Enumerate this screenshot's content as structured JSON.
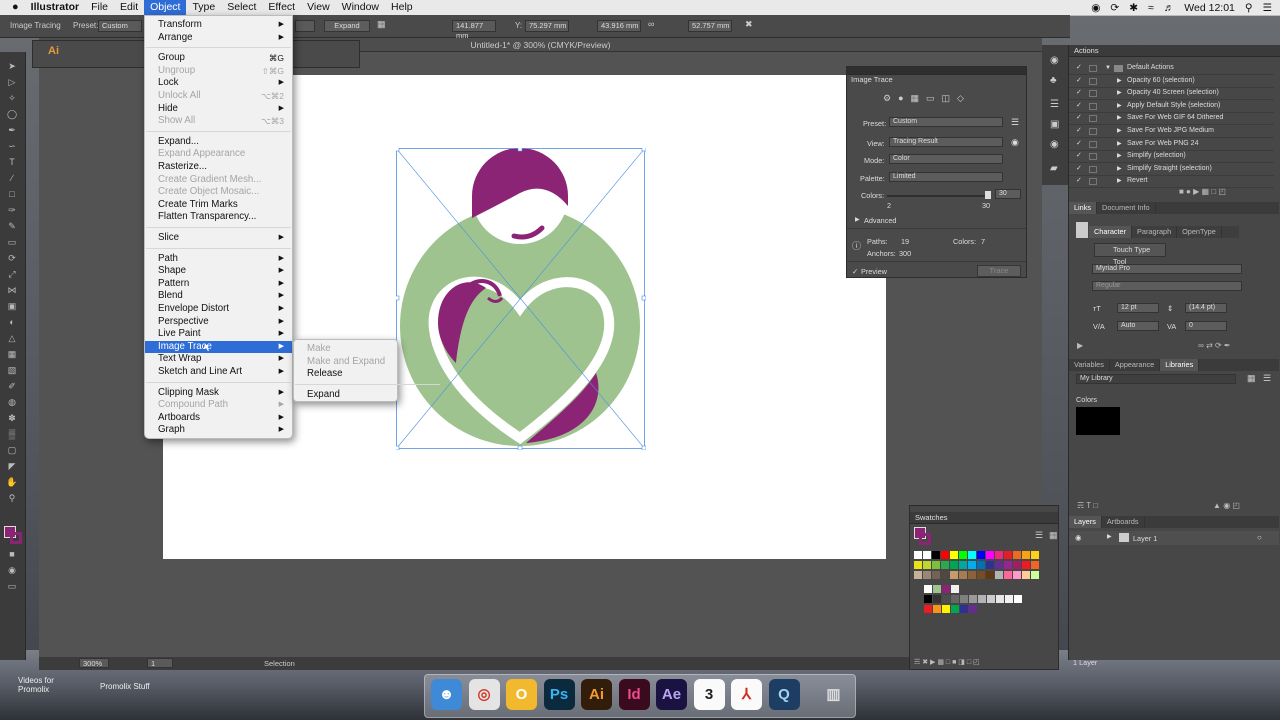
{
  "menubar": {
    "apple": "",
    "app_name": "Illustrator",
    "items": [
      "File",
      "Edit",
      "Object",
      "Type",
      "Select",
      "Effect",
      "View",
      "Window",
      "Help"
    ],
    "active": "Object",
    "clock": "Wed 12:01"
  },
  "control_bar": {
    "mode_label": "Image Tracing",
    "preset_label": "Preset:",
    "preset_value": "Custom",
    "expand_button": "Expand",
    "x_value": "141.877 mm",
    "y_label": "Y:",
    "y_value": "75.297 mm",
    "w_value": "43.916 mm",
    "h_value": "52.757 mm"
  },
  "document": {
    "title": "Untitled-1* @ 300% (CMYK/Preview)"
  },
  "object_menu": {
    "items": [
      {
        "label": "Transform",
        "submenu": true
      },
      {
        "label": "Arrange",
        "submenu": true
      },
      {
        "sep": true
      },
      {
        "label": "Group",
        "shortcut": "⌘G"
      },
      {
        "label": "Ungroup",
        "shortcut": "⇧⌘G",
        "disabled": true
      },
      {
        "label": "Lock",
        "submenu": true
      },
      {
        "label": "Unlock All",
        "shortcut": "⌥⌘2",
        "disabled": true
      },
      {
        "label": "Hide",
        "submenu": true
      },
      {
        "label": "Show All",
        "shortcut": "⌥⌘3",
        "disabled": true
      },
      {
        "sep": true
      },
      {
        "label": "Expand..."
      },
      {
        "label": "Expand Appearance",
        "disabled": true
      },
      {
        "label": "Rasterize..."
      },
      {
        "label": "Create Gradient Mesh...",
        "disabled": true
      },
      {
        "label": "Create Object Mosaic...",
        "disabled": true
      },
      {
        "label": "Create Trim Marks"
      },
      {
        "label": "Flatten Transparency..."
      },
      {
        "sep": true
      },
      {
        "label": "Slice",
        "submenu": true
      },
      {
        "sep": true
      },
      {
        "label": "Path",
        "submenu": true
      },
      {
        "label": "Shape",
        "submenu": true
      },
      {
        "label": "Pattern",
        "submenu": true
      },
      {
        "label": "Blend",
        "submenu": true
      },
      {
        "label": "Envelope Distort",
        "submenu": true
      },
      {
        "label": "Perspective",
        "submenu": true
      },
      {
        "label": "Live Paint",
        "submenu": true
      },
      {
        "label": "Image Trace",
        "submenu": true,
        "selected": true
      },
      {
        "label": "Text Wrap",
        "submenu": true
      },
      {
        "label": "Sketch and Line Art",
        "submenu": true
      },
      {
        "sep": true
      },
      {
        "label": "Clipping Mask",
        "submenu": true
      },
      {
        "label": "Compound Path",
        "submenu": true,
        "disabled": true
      },
      {
        "label": "Artboards",
        "submenu": true
      },
      {
        "label": "Graph",
        "submenu": true
      }
    ]
  },
  "image_trace_submenu": {
    "items": [
      {
        "label": "Make",
        "disabled": true
      },
      {
        "label": "Make and Expand",
        "disabled": true
      },
      {
        "label": "Release"
      },
      {
        "sep": true
      },
      {
        "label": "Expand"
      }
    ]
  },
  "image_trace_panel": {
    "title": "Image Trace",
    "preset_label": "Preset:",
    "preset_value": "Custom",
    "view_label": "View:",
    "view_value": "Tracing Result",
    "mode_label": "Mode:",
    "mode_value": "Color",
    "palette_label": "Palette:",
    "palette_value": "Limited",
    "colors_label": "Colors:",
    "colors_value": "30",
    "slider_min": "2",
    "slider_max": "30",
    "colors_fraction": 1.0,
    "advanced_label": "Advanced",
    "paths_label": "Paths:",
    "paths_value": "19",
    "anchors_label": "Anchors:",
    "anchors_value": "300",
    "colors_count_label": "Colors:",
    "colors_count_value": "7",
    "preview_label": "Preview",
    "trace_button": "Trace"
  },
  "actions_panel": {
    "title": "Actions",
    "set_name": "Default Actions",
    "items": [
      "Opacity 60 (selection)",
      "Opacity 40 Screen (selection)",
      "Apply Default Style (selection)",
      "Save For Web GIF 64 Dithered",
      "Save For Web JPG Medium",
      "Save For Web PNG 24",
      "Simplify (selection)",
      "Simplify Straight (selection)",
      "Revert"
    ]
  },
  "links_tabs": [
    "Links",
    "Document Info"
  ],
  "character_panel": {
    "tabs": [
      "Character",
      "Paragraph",
      "OpenType"
    ],
    "touch_tool": "Touch Type Tool",
    "font_family": "Myriad Pro",
    "font_style": "Regular",
    "size": "12 pt",
    "leading": "(14.4 pt)",
    "kerning": "Auto",
    "tracking": "0"
  },
  "libraries_panel": {
    "tabs": [
      "Variables",
      "Appearance",
      "Libraries"
    ],
    "library": "My Library",
    "section": "Colors"
  },
  "swatches_panel": {
    "title": "Swatches"
  },
  "layers_panel": {
    "tabs": [
      "Layers",
      "Artboards"
    ],
    "layer_name": "Layer 1",
    "footer": "1 Layer"
  },
  "status_bar": {
    "zoom": "300%",
    "artboard": "1",
    "tool": "Selection"
  },
  "desktop": {
    "watermark_1": "Videos for Promolix",
    "watermark_2": "Promolix Stuff"
  },
  "dock_apps": [
    {
      "name": "finder-icon",
      "glyph": "☻",
      "color": "#3e8ad6",
      "fg": "#fff"
    },
    {
      "name": "chrome-icon",
      "glyph": "◎",
      "color": "#e4e4e4",
      "fg": "#d23b2e"
    },
    {
      "name": "opera-icon",
      "glyph": "O",
      "color": "#f2b92e",
      "fg": "#fff"
    },
    {
      "name": "photoshop-icon",
      "glyph": "Ps",
      "color": "#0b2a3d",
      "fg": "#39b4f0"
    },
    {
      "name": "illustrator-icon",
      "glyph": "Ai",
      "color": "#321d0a",
      "fg": "#f29b2a"
    },
    {
      "name": "indesign-icon",
      "glyph": "Id",
      "color": "#3a0a1f",
      "fg": "#f24a8c"
    },
    {
      "name": "aftereffects-icon",
      "glyph": "Ae",
      "color": "#1a1240",
      "fg": "#b9a5f5"
    },
    {
      "name": "calendar-icon",
      "glyph": "3",
      "color": "#fafafa",
      "fg": "#222"
    },
    {
      "name": "acrobat-icon",
      "glyph": "⅄",
      "color": "#fafafa",
      "fg": "#d42b1e"
    },
    {
      "name": "quicktime-icon",
      "glyph": "Q",
      "color": "#1d3e62",
      "fg": "#9fd2f5"
    },
    {
      "name": "trash-icon",
      "glyph": "▥",
      "color": "transparent",
      "fg": "#ddd"
    }
  ],
  "colors": {
    "accent": "#2f6dd6",
    "logo_green": "#9ec38f",
    "logo_purple": "#8c2476",
    "bounding_box": "#4a90e2"
  }
}
